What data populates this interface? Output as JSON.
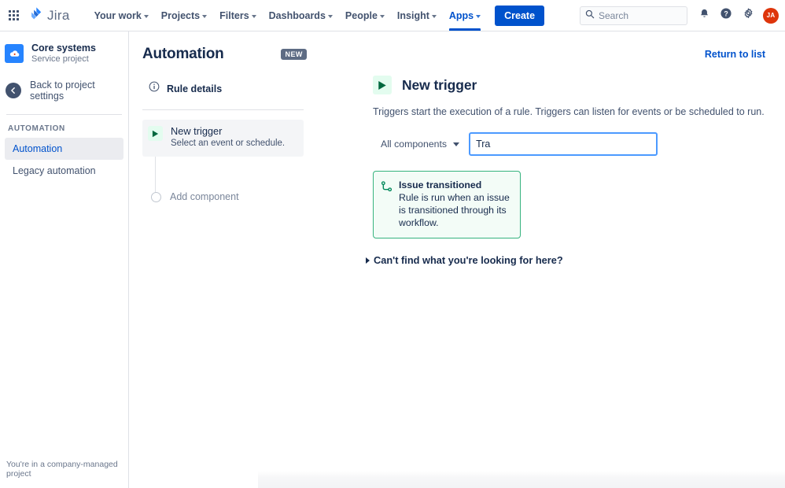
{
  "topnav": {
    "app_switcher_icon": "grid-dots-icon",
    "brand_icon": "jira-logo-icon",
    "brand_label": "Jira",
    "items": [
      {
        "label": "Your work",
        "has_caret": true,
        "active": false
      },
      {
        "label": "Projects",
        "has_caret": true,
        "active": false
      },
      {
        "label": "Filters",
        "has_caret": true,
        "active": false
      },
      {
        "label": "Dashboards",
        "has_caret": true,
        "active": false
      },
      {
        "label": "People",
        "has_caret": true,
        "active": false
      },
      {
        "label": "Insight",
        "has_caret": true,
        "active": false
      },
      {
        "label": "Apps",
        "has_caret": true,
        "active": true
      }
    ],
    "create_label": "Create",
    "search_placeholder": "Search",
    "search_value": "",
    "search_icon": "search-icon",
    "notifications_icon": "bell-icon",
    "help_icon": "help-circle-icon",
    "settings_icon": "gear-icon",
    "avatar_initials": "JA",
    "accent_color": "#0052cc",
    "avatar_color": "#de350b"
  },
  "sidebar": {
    "project_icon": "service-project-cloud-icon",
    "project_name": "Core systems",
    "project_type": "Service project",
    "back_icon": "arrow-left-circle-icon",
    "back_label": "Back to project settings",
    "section_title": "AUTOMATION",
    "items": [
      {
        "label": "Automation",
        "selected": true
      },
      {
        "label": "Legacy automation",
        "selected": false
      }
    ],
    "footer_note": "You're in a company-managed project"
  },
  "page": {
    "title": "Automation",
    "new_badge": "NEW",
    "return_link": "Return to list"
  },
  "rule_panel": {
    "details_icon": "info-circle-icon",
    "details_label": "Rule details",
    "trigger": {
      "icon": "play-triangle-icon",
      "title": "New trigger",
      "subtitle": "Select an event or schedule."
    },
    "add_component_label": "Add component",
    "add_component_icon": "empty-circle-icon"
  },
  "detail_panel": {
    "icon": "play-triangle-icon",
    "title": "New trigger",
    "description": "Triggers start the execution of a rule. Triggers can listen for events or be scheduled to run.",
    "component_filter": {
      "label": "All components",
      "caret_icon": "chevron-down-icon"
    },
    "search": {
      "value": "Tra",
      "placeholder": ""
    },
    "results": [
      {
        "icon": "workflow-transition-icon",
        "title": "Issue transitioned",
        "description": "Rule is run when an issue is transitioned through its workflow.",
        "border_color": "#36b37e",
        "background_color": "#f3fcf7"
      }
    ],
    "cant_find": {
      "label": "Can't find what you're looking for here?",
      "icon": "chevron-right-icon"
    }
  }
}
